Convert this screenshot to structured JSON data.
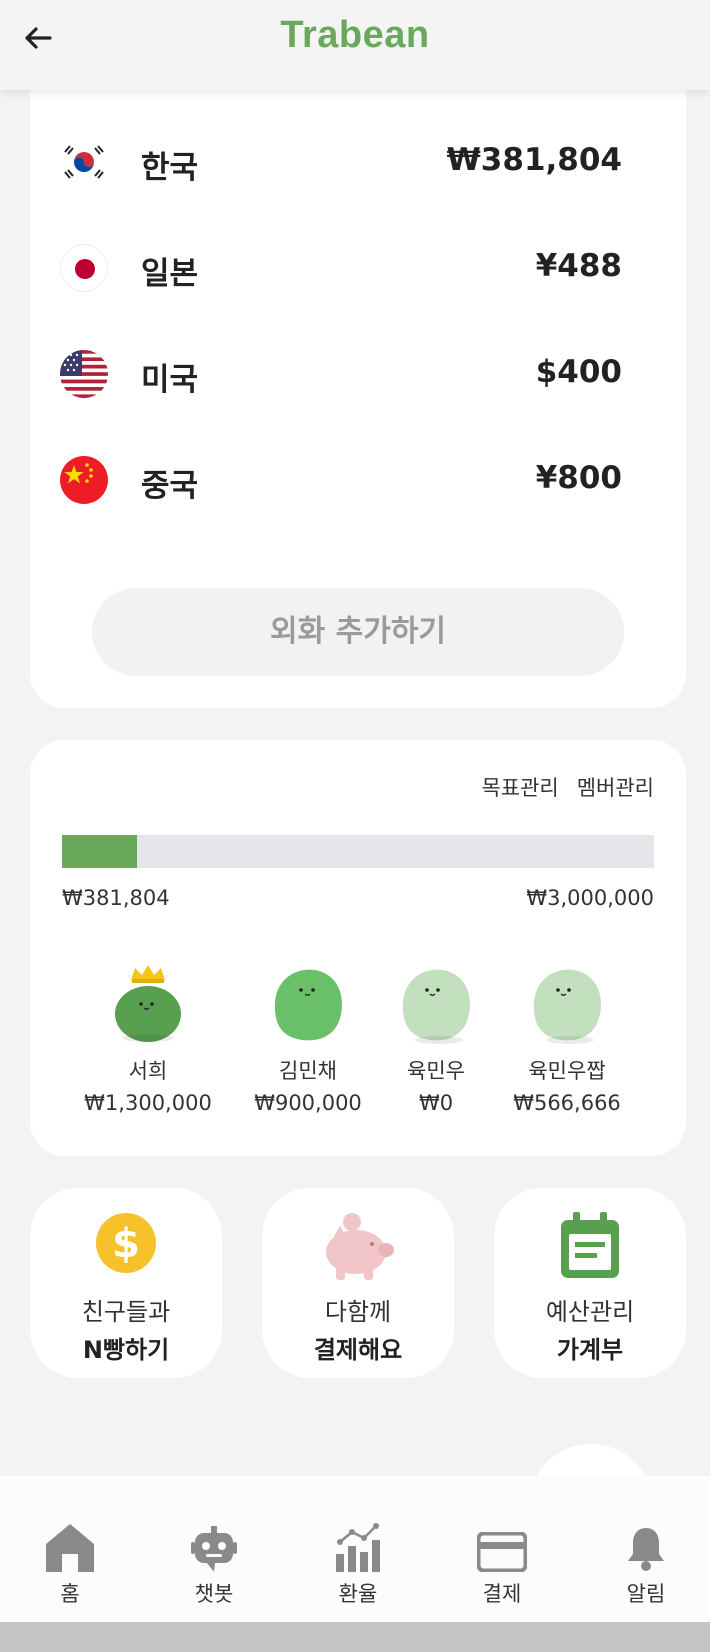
{
  "header": {
    "title": "Trabean",
    "back_icon": "arrow-left-icon"
  },
  "currencies": [
    {
      "country": "한국",
      "amount": "₩381,804",
      "flag": "kr-flag-icon"
    },
    {
      "country": "일본",
      "amount": "¥488",
      "flag": "jp-flag-icon"
    },
    {
      "country": "미국",
      "amount": "$400",
      "flag": "us-flag-icon"
    },
    {
      "country": "중국",
      "amount": "¥800",
      "flag": "cn-flag-icon"
    }
  ],
  "add_currency_label": "외화 추가하기",
  "goal": {
    "goal_manage": "목표관리",
    "member_manage": "멤버관리",
    "current": "₩381,804",
    "target": "₩3,000,000",
    "progress_fraction": 0.127
  },
  "members": [
    {
      "name": "서희",
      "amount": "₩1,300,000",
      "color": "#58a050",
      "crown": true
    },
    {
      "name": "김민채",
      "amount": "₩900,000",
      "color": "#6abf69",
      "crown": false
    },
    {
      "name": "육민우",
      "amount": "₩0",
      "color": "#c2e0bd",
      "crown": false
    },
    {
      "name": "육민우짭",
      "amount": "₩566,666",
      "color": "#c2e0bd",
      "crown": false
    }
  ],
  "tiles": [
    {
      "line1": "친구들과",
      "line2": "N빵하기",
      "icon": "dollar-coin-icon"
    },
    {
      "line1": "다함께",
      "line2": "결제해요",
      "icon": "piggy-bank-icon"
    },
    {
      "line1": "예산관리",
      "line2": "가계부",
      "icon": "calendar-icon"
    }
  ],
  "tabs": [
    {
      "label": "홈",
      "icon": "home-icon"
    },
    {
      "label": "챗봇",
      "icon": "robot-icon"
    },
    {
      "label": "환율",
      "icon": "chart-icon"
    },
    {
      "label": "결제",
      "icon": "credit-card-icon"
    },
    {
      "label": "알림",
      "icon": "bell-icon"
    }
  ],
  "colors": {
    "brand": "#6aa85b",
    "progress_track": "#e5e6ea",
    "tab_icon": "#8a8a8a"
  }
}
